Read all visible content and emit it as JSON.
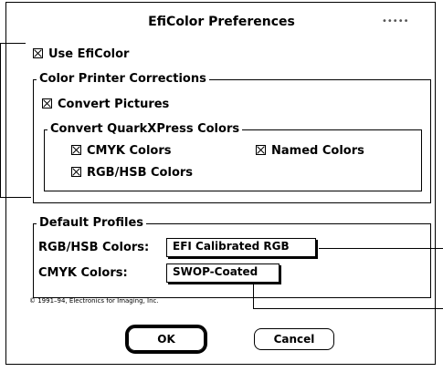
{
  "dialog": {
    "title": "EfiColor Preferences",
    "grip": "•••••"
  },
  "use_eficolor": {
    "label": "Use EfiColor",
    "checked": true
  },
  "color_printer": {
    "label": "Color Printer Corrections",
    "convert_pictures": {
      "label": "Convert Pictures",
      "checked": true
    },
    "quark": {
      "label": "Convert QuarkXPress Colors",
      "cmyk": {
        "label": "CMYK Colors",
        "checked": true
      },
      "named": {
        "label": "Named Colors",
        "checked": true
      },
      "rgb_hsb": {
        "label": "RGB/HSB Colors",
        "checked": true
      }
    }
  },
  "default_profiles": {
    "label": "Default Profiles",
    "rgb_label": "RGB/HSB Colors:",
    "rgb_value": "EFI Calibrated RGB",
    "cmyk_label": "CMYK Colors:",
    "cmyk_value": "SWOP-Coated"
  },
  "copyright": "© 1991–94, Electronics for Imaging, Inc.",
  "buttons": {
    "ok": "OK",
    "cancel": "Cancel"
  }
}
